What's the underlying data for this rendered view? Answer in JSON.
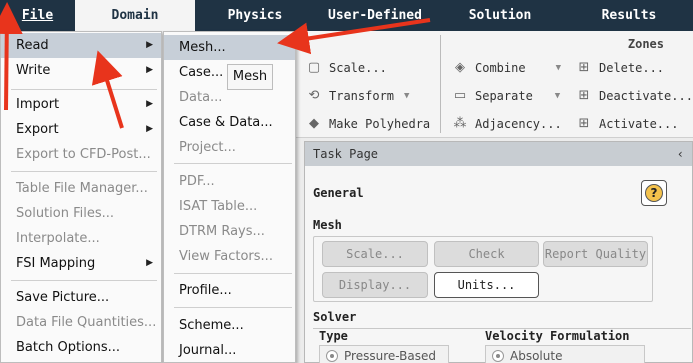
{
  "tabs": [
    "File",
    "Domain",
    "Physics",
    "User-Defined",
    "Solution",
    "Results"
  ],
  "ribbon": {
    "group_label": "Zones",
    "col1": [
      {
        "label": "Scale...",
        "icon": "scale-icon"
      },
      {
        "label": "Transform",
        "icon": "transform-icon"
      },
      {
        "label": "Make Polyhedra",
        "icon": "polyhedra-icon"
      }
    ],
    "col2": [
      {
        "label": "Combine",
        "icon": "combine-icon"
      },
      {
        "label": "Separate",
        "icon": "separate-icon"
      },
      {
        "label": "Adjacency...",
        "icon": "adjacency-icon"
      }
    ],
    "col3": [
      {
        "label": "Delete...",
        "icon": "grid-delete-icon"
      },
      {
        "label": "Deactivate...",
        "icon": "grid-deactivate-icon"
      },
      {
        "label": "Activate...",
        "icon": "grid-activate-icon"
      }
    ]
  },
  "file_menu": {
    "items": [
      {
        "label": "Read",
        "submenu": true,
        "disabled": false
      },
      {
        "label": "Write",
        "submenu": true,
        "disabled": false
      },
      {
        "label": "Import",
        "submenu": true,
        "disabled": false
      },
      {
        "label": "Export",
        "submenu": true,
        "disabled": false
      },
      {
        "label": "Export to CFD-Post...",
        "submenu": false,
        "disabled": true
      },
      {
        "label": "Table File Manager...",
        "submenu": false,
        "disabled": true
      },
      {
        "label": "Solution Files...",
        "submenu": false,
        "disabled": true
      },
      {
        "label": "Interpolate...",
        "submenu": false,
        "disabled": true
      },
      {
        "label": "FSI Mapping",
        "submenu": true,
        "disabled": false
      },
      {
        "label": "Save Picture...",
        "submenu": false,
        "disabled": false
      },
      {
        "label": "Data File Quantities...",
        "submenu": false,
        "disabled": true
      },
      {
        "label": "Batch Options...",
        "submenu": false,
        "disabled": false
      }
    ]
  },
  "read_menu": {
    "items": [
      {
        "label": "Mesh...",
        "disabled": false
      },
      {
        "label": "Case...",
        "disabled": false
      },
      {
        "label": "Data...",
        "disabled": true
      },
      {
        "label": "Case & Data...",
        "disabled": false
      },
      {
        "label": "Project...",
        "disabled": true
      },
      {
        "label": "PDF...",
        "disabled": true
      },
      {
        "label": "ISAT Table...",
        "disabled": true
      },
      {
        "label": "DTRM Rays...",
        "disabled": true
      },
      {
        "label": "View Factors...",
        "disabled": true
      },
      {
        "label": "Profile...",
        "disabled": false
      },
      {
        "label": "Scheme...",
        "disabled": false
      },
      {
        "label": "Journal...",
        "disabled": false
      }
    ]
  },
  "tooltip": "Mesh",
  "task_page": {
    "header": "Task Page",
    "collapse": "‹",
    "title": "General",
    "help": "?",
    "mesh_label": "Mesh",
    "mesh_buttons": {
      "scale": "Scale...",
      "check": "Check",
      "report_quality": "Report Quality",
      "display": "Display...",
      "units": "Units..."
    },
    "solver_label": "Solver",
    "type_label": "Type",
    "velocity_label": "Velocity Formulation",
    "type_option": "Pressure-Based",
    "velocity_option": "Absolute"
  },
  "colors": {
    "tabbar": "#1f3344",
    "highlight": "#c7cfd8",
    "arrow": "#e8341c"
  }
}
